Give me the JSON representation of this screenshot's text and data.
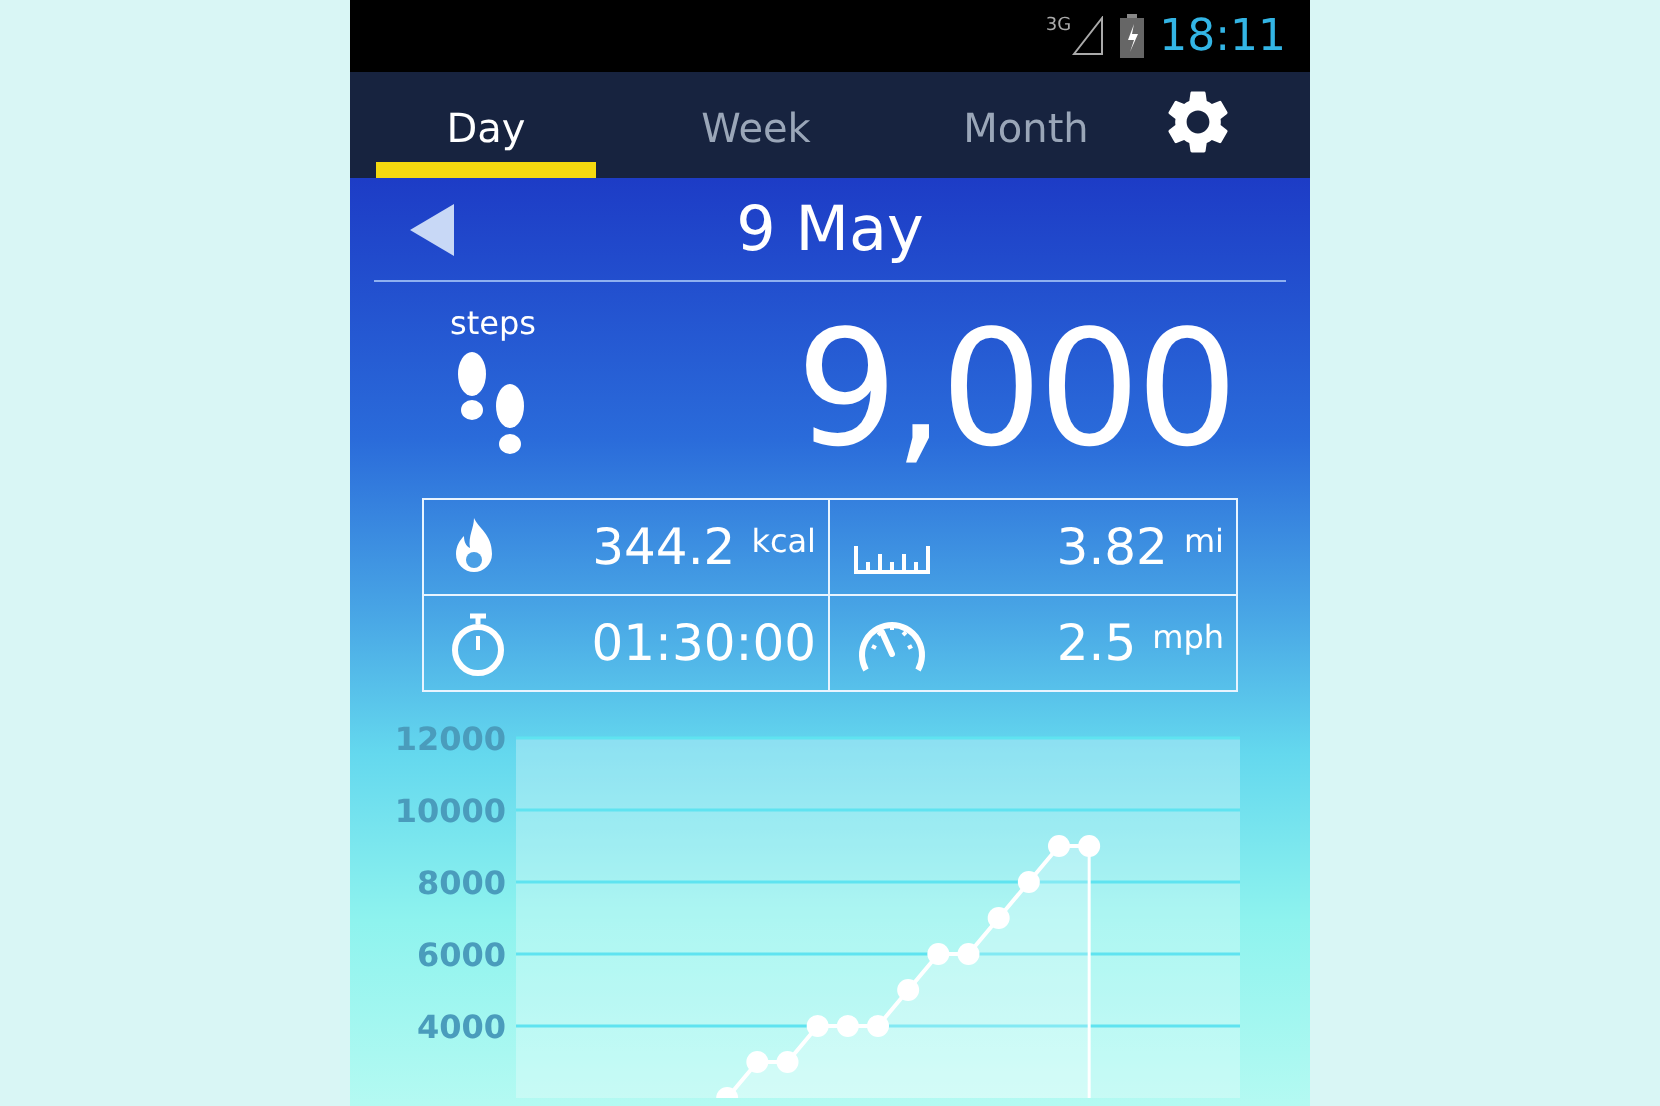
{
  "status_bar": {
    "network": "3G",
    "time": "18:11"
  },
  "tabs": [
    {
      "label": "Day",
      "selected": true
    },
    {
      "label": "Week",
      "selected": false
    },
    {
      "label": "Month",
      "selected": false
    }
  ],
  "date": {
    "label": "9 May"
  },
  "steps": {
    "label": "steps",
    "value": "9,000"
  },
  "stats": [
    {
      "kind": "calories",
      "value": "344.2",
      "unit": "kcal"
    },
    {
      "kind": "distance",
      "value": "3.82",
      "unit": "mi"
    },
    {
      "kind": "duration",
      "value": "01:30:00"
    },
    {
      "kind": "speed",
      "value": "2.5",
      "unit": "mph"
    }
  ],
  "chart": {
    "chart_data": {
      "type": "line",
      "categories": [
        null,
        null,
        null,
        null,
        null,
        null,
        null,
        null,
        null,
        null,
        null,
        null,
        null,
        null,
        null,
        null,
        null,
        null,
        null,
        null,
        null,
        null,
        null,
        null,
        null
      ],
      "grid": true,
      "series": [
        {
          "color": "#ffffff",
          "marker": "circle",
          "values": [
            null,
            null,
            null,
            null,
            null,
            null,
            null,
            2000,
            3000,
            3000,
            4000,
            4000,
            4000,
            5000,
            6000,
            6000,
            7000,
            8000,
            9000,
            9000,
            null,
            null,
            null,
            null,
            null
          ]
        }
      ],
      "ylim": [
        2000,
        12000
      ],
      "yticks": [
        4000,
        6000,
        8000,
        10000,
        12000
      ]
    }
  }
}
